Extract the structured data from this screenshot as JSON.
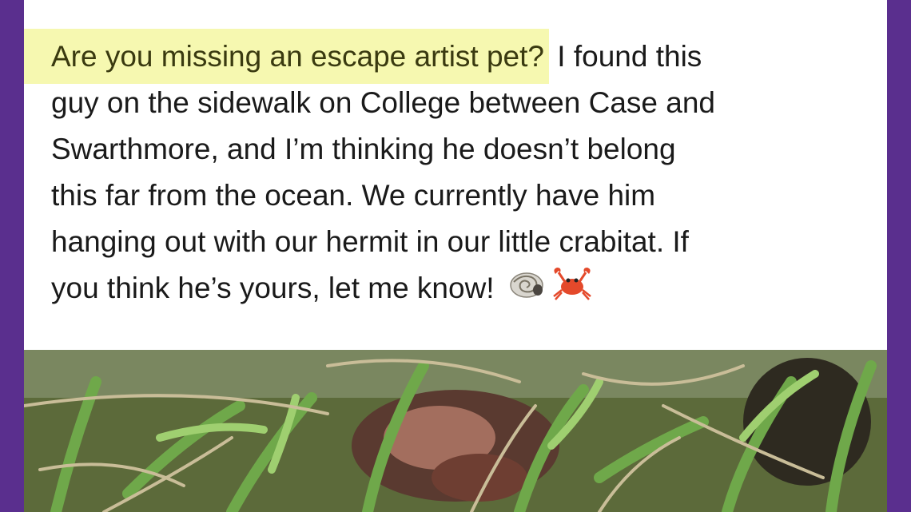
{
  "post": {
    "highlight": "Are you missing an escape artist pet?",
    "line1_rest": " I found this",
    "line2": "guy on the sidewalk on College between Case and",
    "line3": "Swarthmore, and I’m thinking he doesn’t belong",
    "line4": "this far from the ocean. We currently have him",
    "line5": "hanging out with our hermit in our little crabitat. If",
    "line6": "you think he’s yours, let me know!"
  },
  "icons": {
    "shell": "spiral-shell-emoji",
    "crab": "crab-emoji"
  },
  "colors": {
    "frame": "#5a2f8e",
    "highlight": "#f6f8b0",
    "text": "#1a1a1a"
  }
}
